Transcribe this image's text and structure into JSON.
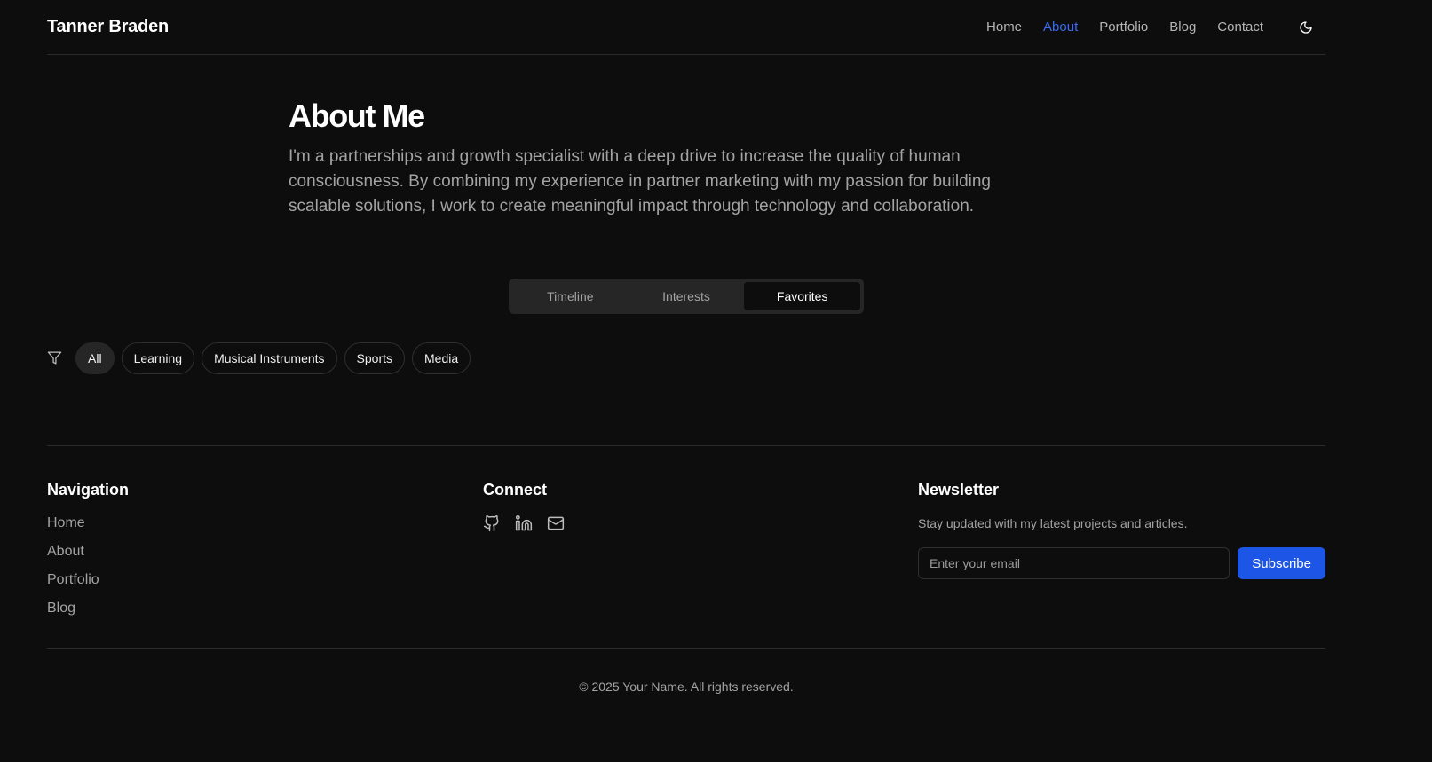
{
  "header": {
    "brand": "Tanner Braden",
    "nav": [
      "Home",
      "About",
      "Portfolio",
      "Blog",
      "Contact"
    ],
    "active_nav": "About",
    "theme_icon": "moon-icon"
  },
  "about": {
    "title": "About Me",
    "body": "I'm a partnerships and growth specialist with a deep drive to increase the quality of human consciousness. By combining my experience in partner marketing with my passion for building scalable solutions, I work to create meaningful impact through technology and collaboration."
  },
  "tabs": {
    "items": [
      "Timeline",
      "Interests",
      "Favorites"
    ],
    "active": "Favorites"
  },
  "filters": {
    "icon": "filter-icon",
    "chips": [
      "All",
      "Learning",
      "Musical Instruments",
      "Sports",
      "Media"
    ],
    "active": "All"
  },
  "footer": {
    "navigation": {
      "heading": "Navigation",
      "links": [
        "Home",
        "About",
        "Portfolio",
        "Blog"
      ]
    },
    "connect": {
      "heading": "Connect",
      "icons": [
        "github-icon",
        "linkedin-icon",
        "mail-icon"
      ]
    },
    "newsletter": {
      "heading": "Newsletter",
      "description": "Stay updated with my latest projects and articles.",
      "placeholder": "Enter your email",
      "button": "Subscribe"
    },
    "copyright": "© 2025 Your Name. All rights reserved."
  },
  "colors": {
    "background": "#0d0d0d",
    "accent": "#1d56e6",
    "active_link": "#3b6cf0"
  }
}
